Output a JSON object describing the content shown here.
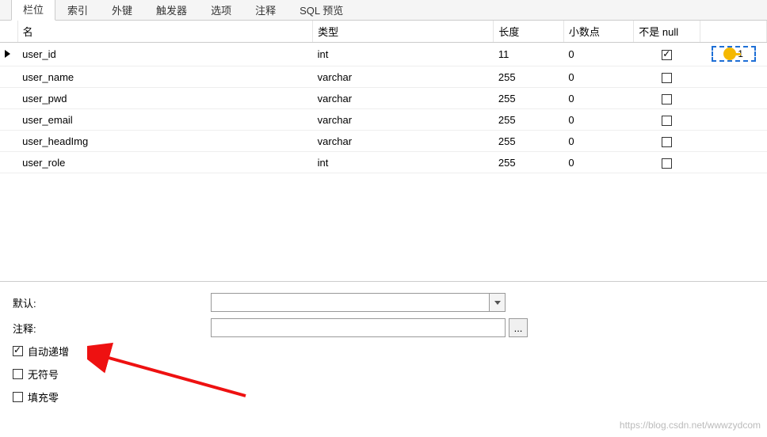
{
  "tabs": [
    {
      "label": "栏位",
      "active": true
    },
    {
      "label": "索引",
      "active": false
    },
    {
      "label": "外键",
      "active": false
    },
    {
      "label": "触发器",
      "active": false
    },
    {
      "label": "选项",
      "active": false
    },
    {
      "label": "注释",
      "active": false
    },
    {
      "label": "SQL 预览",
      "active": false
    }
  ],
  "columns": {
    "name": "名",
    "type": "类型",
    "length": "长度",
    "decimals": "小数点",
    "notnull": "不是 null"
  },
  "rows": [
    {
      "selected": true,
      "name": "user_id",
      "type": "int",
      "length": "11",
      "decimals": "0",
      "notnull": true,
      "key": "1"
    },
    {
      "selected": false,
      "name": "user_name",
      "type": "varchar",
      "length": "255",
      "decimals": "0",
      "notnull": false,
      "key": ""
    },
    {
      "selected": false,
      "name": "user_pwd",
      "type": "varchar",
      "length": "255",
      "decimals": "0",
      "notnull": false,
      "key": ""
    },
    {
      "selected": false,
      "name": "user_email",
      "type": "varchar",
      "length": "255",
      "decimals": "0",
      "notnull": false,
      "key": ""
    },
    {
      "selected": false,
      "name": "user_headImg",
      "type": "varchar",
      "length": "255",
      "decimals": "0",
      "notnull": false,
      "key": ""
    },
    {
      "selected": false,
      "name": "user_role",
      "type": "int",
      "length": "255",
      "decimals": "0",
      "notnull": false,
      "key": ""
    }
  ],
  "detail": {
    "default_label": "默认:",
    "default_value": "",
    "comment_label": "注释:",
    "comment_value": "",
    "ellipsis": "...",
    "auto_increment_label": "自动递增",
    "auto_increment_checked": true,
    "unsigned_label": "无符号",
    "unsigned_checked": false,
    "zerofill_label": "填充零",
    "zerofill_checked": false
  },
  "watermark": "https://blog.csdn.net/wwwzydcom"
}
